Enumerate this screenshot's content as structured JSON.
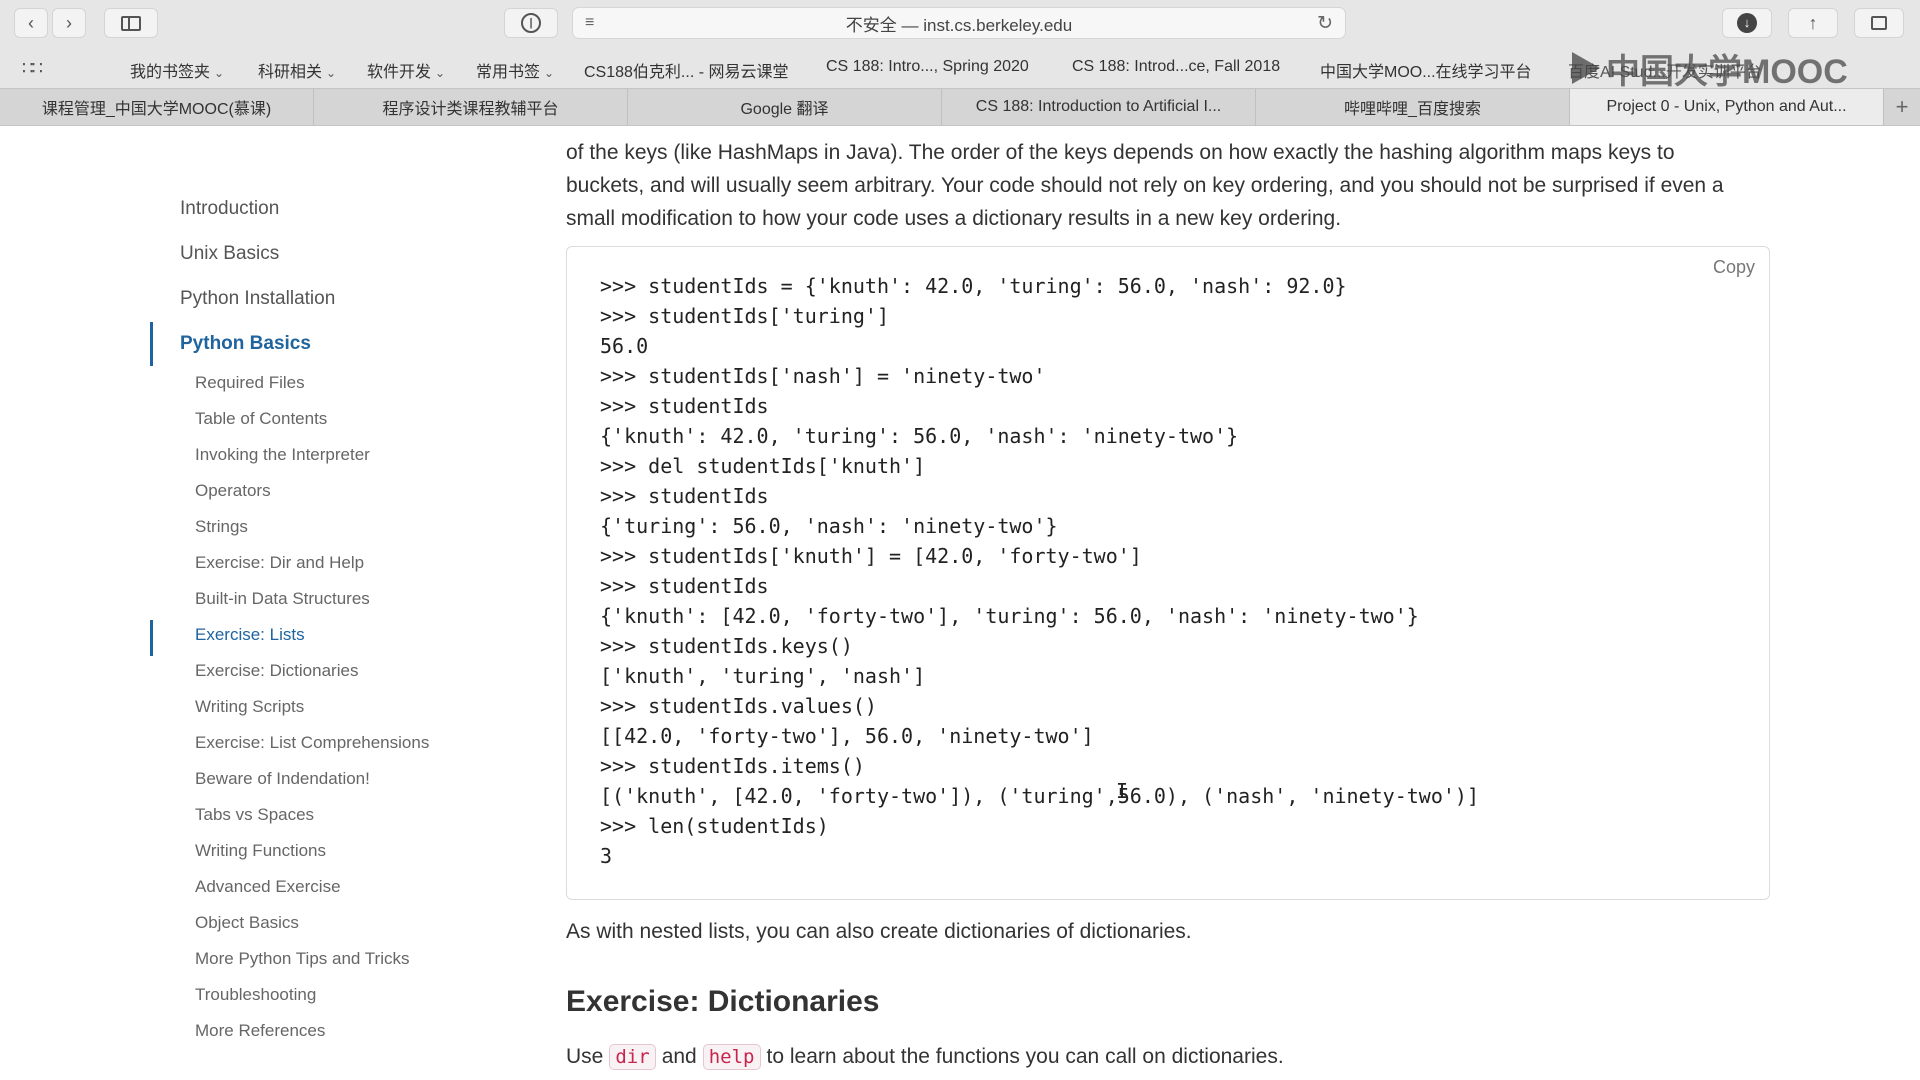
{
  "browser": {
    "address": "不安全 — inst.cs.berkeley.edu",
    "bookmarks": [
      {
        "label": "我的书签夹",
        "caret": true
      },
      {
        "label": "科研相关",
        "caret": true
      },
      {
        "label": "软件开发",
        "caret": true
      },
      {
        "label": "常用书签",
        "caret": true
      },
      {
        "label": "CS188伯克利... - 网易云课堂",
        "caret": false
      },
      {
        "label": "CS 188: Intro..., Spring 2020",
        "caret": false
      },
      {
        "label": "CS 188: Introd...ce, Fall 2018",
        "caret": false
      },
      {
        "label": "中国大学MOO...在线学习平台",
        "caret": false
      },
      {
        "label": "百度AI Stud...开发实训平台",
        "caret": false
      }
    ],
    "watermark": "中国大学MOOC",
    "tabs": [
      {
        "label": "课程管理_中国大学MOOC(慕课)"
      },
      {
        "label": "程序设计类课程教辅平台"
      },
      {
        "label": "Google 翻译"
      },
      {
        "label": "CS 188: Introduction to Artificial I..."
      },
      {
        "label": "哔哩哔哩_百度搜索"
      },
      {
        "label": "Project 0 - Unix, Python and Aut..."
      }
    ],
    "new_tab": "+"
  },
  "sidebar": {
    "top_items": [
      "Introduction",
      "Unix Basics",
      "Python Installation",
      "Python Basics"
    ],
    "sub_items": [
      "Required Files",
      "Table of Contents",
      "Invoking the Interpreter",
      "Operators",
      "Strings",
      "Exercise: Dir and Help",
      "Built-in Data Structures",
      "Exercise: Lists",
      "Exercise: Dictionaries",
      "Writing Scripts",
      "Exercise: List Comprehensions",
      "Beware of Indendation!",
      "Tabs vs Spaces",
      "Writing Functions",
      "Advanced Exercise",
      "Object Basics",
      "More Python Tips and Tricks",
      "Troubleshooting",
      "More References"
    ]
  },
  "main": {
    "intro_lines": [
      "of the keys (like HashMaps in Java). The order of the keys depends on how exactly the hashing algorithm maps keys to",
      "buckets, and will usually seem arbitrary. Your code should not rely on key ordering, and you should not be surprised if even a",
      "small modification to how your code uses a dictionary results in a new key ordering."
    ],
    "copy_label": "Copy",
    "code": [
      ">>> studentIds = {'knuth': 42.0, 'turing': 56.0, 'nash': 92.0}",
      ">>> studentIds['turing']",
      "56.0",
      ">>> studentIds['nash'] = 'ninety-two'",
      ">>> studentIds",
      "{'knuth': 42.0, 'turing': 56.0, 'nash': 'ninety-two'}",
      ">>> del studentIds['knuth']",
      ">>> studentIds",
      "{'turing': 56.0, 'nash': 'ninety-two'}",
      ">>> studentIds['knuth'] = [42.0, 'forty-two']",
      ">>> studentIds",
      "{'knuth': [42.0, 'forty-two'], 'turing': 56.0, 'nash': 'ninety-two'}",
      ">>> studentIds.keys()",
      "['knuth', 'turing', 'nash']",
      ">>> studentIds.values()",
      "[[42.0, 'forty-two'], 56.0, 'ninety-two']",
      ">>> studentIds.items()",
      "[('knuth', [42.0, 'forty-two']), ('turing',56.0), ('nash', 'ninety-two')]",
      ">>> len(studentIds)",
      "3"
    ],
    "after_code": "As with nested lists, you can also create dictionaries of dictionaries.",
    "section_title": "Exercise: Dictionaries",
    "use_prefix": "Use",
    "use_code1": "dir",
    "use_and": "and",
    "use_code2": "help",
    "use_suffix": "to learn about the functions you can call on dictionaries."
  }
}
